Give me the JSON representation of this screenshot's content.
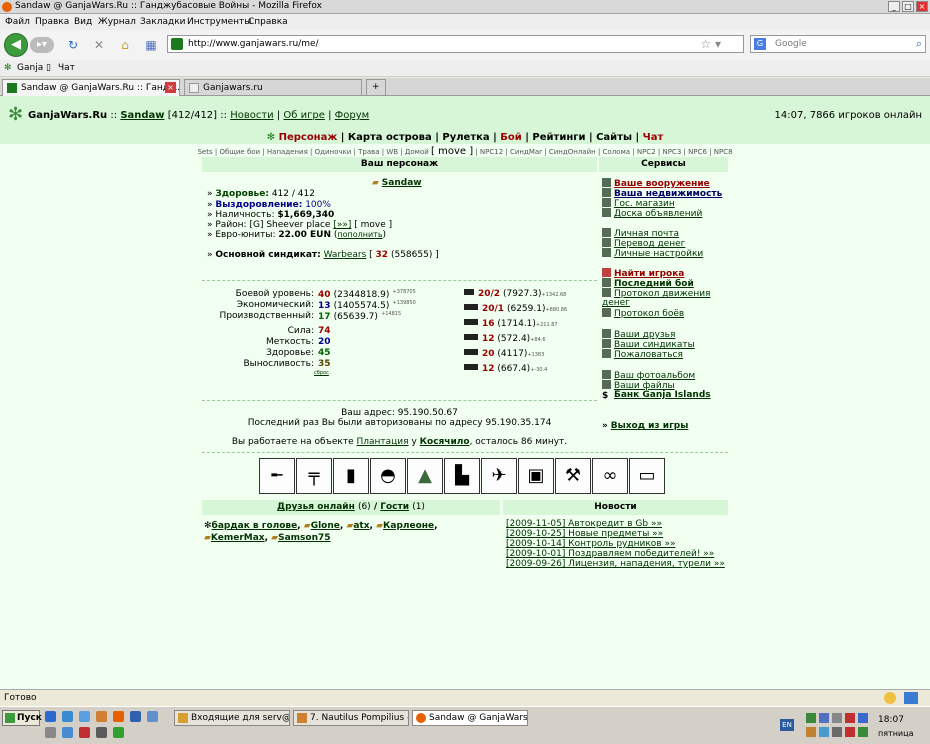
{
  "window": {
    "title": "Sandaw @ GanjaWars.Ru :: Ганджубасовые Войны - Mozilla Firefox"
  },
  "menu": [
    "Файл",
    "Правка",
    "Вид",
    "Журнал",
    "Закладки",
    "Инструменты",
    "Справка"
  ],
  "address": {
    "url": "http://www.ganjawars.ru/me/"
  },
  "search": {
    "placeholder": "Google",
    "engine": "G"
  },
  "bookmarks": [
    "Ganja",
    "Чат"
  ],
  "tabs": [
    {
      "label": "Sandaw @ GanjaWars.Ru :: Гандж...",
      "active": true
    },
    {
      "label": "Ganjawars.ru",
      "active": false
    }
  ],
  "site": {
    "name": "GanjaWars.Ru",
    "sep1": "::",
    "user": "Sandaw",
    "user_hp": "[412/412]",
    "sep2": "::",
    "links": [
      "Новости",
      "Об игре",
      "Форум"
    ],
    "status": "14:07, 7866 игроков онлайн"
  },
  "main_menu": {
    "items": [
      "Персонаж",
      "Карта острова",
      "Рулетка",
      "Бой",
      "Рейтинги",
      "Сайты",
      "Чат"
    ],
    "sub_items": [
      "Sets",
      "Общие бои",
      "Нападения",
      "Одиночки",
      "Трава",
      "WB",
      "Домой",
      "[ move ]",
      "NPC12",
      "СиндMar",
      "СиндОнлайн",
      "Солома",
      "NPC2",
      "NPC3",
      "NPC6",
      "NPC8"
    ]
  },
  "character": {
    "header": "Ваш персонаж",
    "name": "Sandaw",
    "health_label": "Здоровье:",
    "health_value": "412 / 412",
    "recovery_label": "Выздоровление:",
    "recovery_value": "100%",
    "cash_label": "Наличность:",
    "cash_value": "$1,669,340",
    "region_label": "Район:",
    "region_value": "[G] Sheever place",
    "region_link": "[»»]",
    "region_move": "[ move ]",
    "eun_label": "Евро-юниты:",
    "eun_value": "22.00 EUN",
    "eun_link": "пополнить",
    "syndicate_label": "Основной синдикат:",
    "syndicate_name": "Warbears",
    "syndicate_level": "32",
    "syndicate_pts": "(558655)",
    "levels": [
      {
        "label": "Боевой уровень:",
        "value": "40",
        "pts": "(2344818.9)",
        "delta": "+378705"
      },
      {
        "label": "Экономический:",
        "value": "13",
        "pts": "(1405574.5)",
        "delta": "+139850"
      },
      {
        "label": "Производственный:",
        "value": "17",
        "pts": "(65639.7)",
        "delta": "+14815"
      }
    ],
    "stats": [
      {
        "label": "Сила:",
        "value": "74"
      },
      {
        "label": "Меткость:",
        "value": "20"
      },
      {
        "label": "Здоровье:",
        "value": "45"
      },
      {
        "label": "Выносливость:",
        "value": "35"
      }
    ],
    "reset_link": "сброс",
    "weapons": [
      {
        "lvl": "20/2",
        "pts": "(7927.3)",
        "delta": "+1342.68"
      },
      {
        "lvl": "20/1",
        "pts": "(6259.1)",
        "delta": "+880.86"
      },
      {
        "lvl": "16",
        "pts": "(1714.1)",
        "delta": "+211.87"
      },
      {
        "lvl": "12",
        "pts": "(572.4)",
        "delta": "+84.6"
      },
      {
        "lvl": "20",
        "pts": "(4117)",
        "delta": "+1383"
      },
      {
        "lvl": "12",
        "pts": "(667.4)",
        "delta": "+-30.4"
      }
    ],
    "address_line": "Ваш адрес: 95.190.50.67",
    "last_login": "Последний раз Вы были авторизованы по адресу 95.190.35.174",
    "work_prefix": "Вы работаете на объекте",
    "work_object": "Плантация",
    "work_mid": "у",
    "work_owner": "Косячило",
    "work_suffix": ", осталось 86 минут."
  },
  "services": {
    "header": "Сервисы",
    "items": [
      {
        "label": "Ваше вооружение",
        "style": "red"
      },
      {
        "label": "Ваша недвижимость",
        "style": "bold"
      },
      {
        "label": "Гос. магазин",
        "style": ""
      },
      {
        "label": "Доска объявлений",
        "style": ""
      },
      {
        "label": "Личная почта",
        "style": ""
      },
      {
        "label": "Перевод денег",
        "style": ""
      },
      {
        "label": "Личные настройки",
        "style": ""
      },
      {
        "label": "Найти игрока",
        "style": "red"
      },
      {
        "label": "Последний бой",
        "style": "bold"
      },
      {
        "label": "Протокол движения",
        "style": ""
      },
      {
        "label": "денег",
        "style": ""
      },
      {
        "label": "Протокол боёв",
        "style": ""
      },
      {
        "label": "Ваши друзья",
        "style": ""
      },
      {
        "label": "Ваши синдикаты",
        "style": ""
      },
      {
        "label": "Пожаловаться",
        "style": ""
      },
      {
        "label": "Ваш фотоальбом",
        "style": ""
      },
      {
        "label": "Ваши файлы",
        "style": ""
      },
      {
        "label": "Банк Ganja Islands",
        "style": "bold"
      },
      {
        "label": "Выход из игры",
        "style": "bold"
      }
    ]
  },
  "friends": {
    "online_label": "Друзья онлайн",
    "online_count": "(6)",
    "sep": "/",
    "guests_label": "Гости",
    "guests_count": "(1)",
    "names": [
      "бардак в голове",
      "Glone",
      "atx",
      "Карлеоне",
      "KemerMax",
      "Samson75"
    ]
  },
  "news": {
    "header": "Новости",
    "items": [
      "[2009-11-05] Автокредит в Gb »»",
      "[2009-10-25] Новые предметы »»",
      "[2009-10-14] Контроль рудников »»",
      "[2009-10-01] Поздравляем победителей! »»",
      "[2009-09-26] Лицензия, нападения, турели »»"
    ]
  },
  "statusbar": {
    "text": "Готово"
  },
  "taskbar": {
    "start": "Пуск",
    "tasks": [
      "Входящие для serv@illr...",
      "7. Nautilus Pompilius - Пр...",
      "Sandaw @ GanjaWars..."
    ],
    "lang": "EN",
    "time": "18:07",
    "day": "пятница"
  }
}
